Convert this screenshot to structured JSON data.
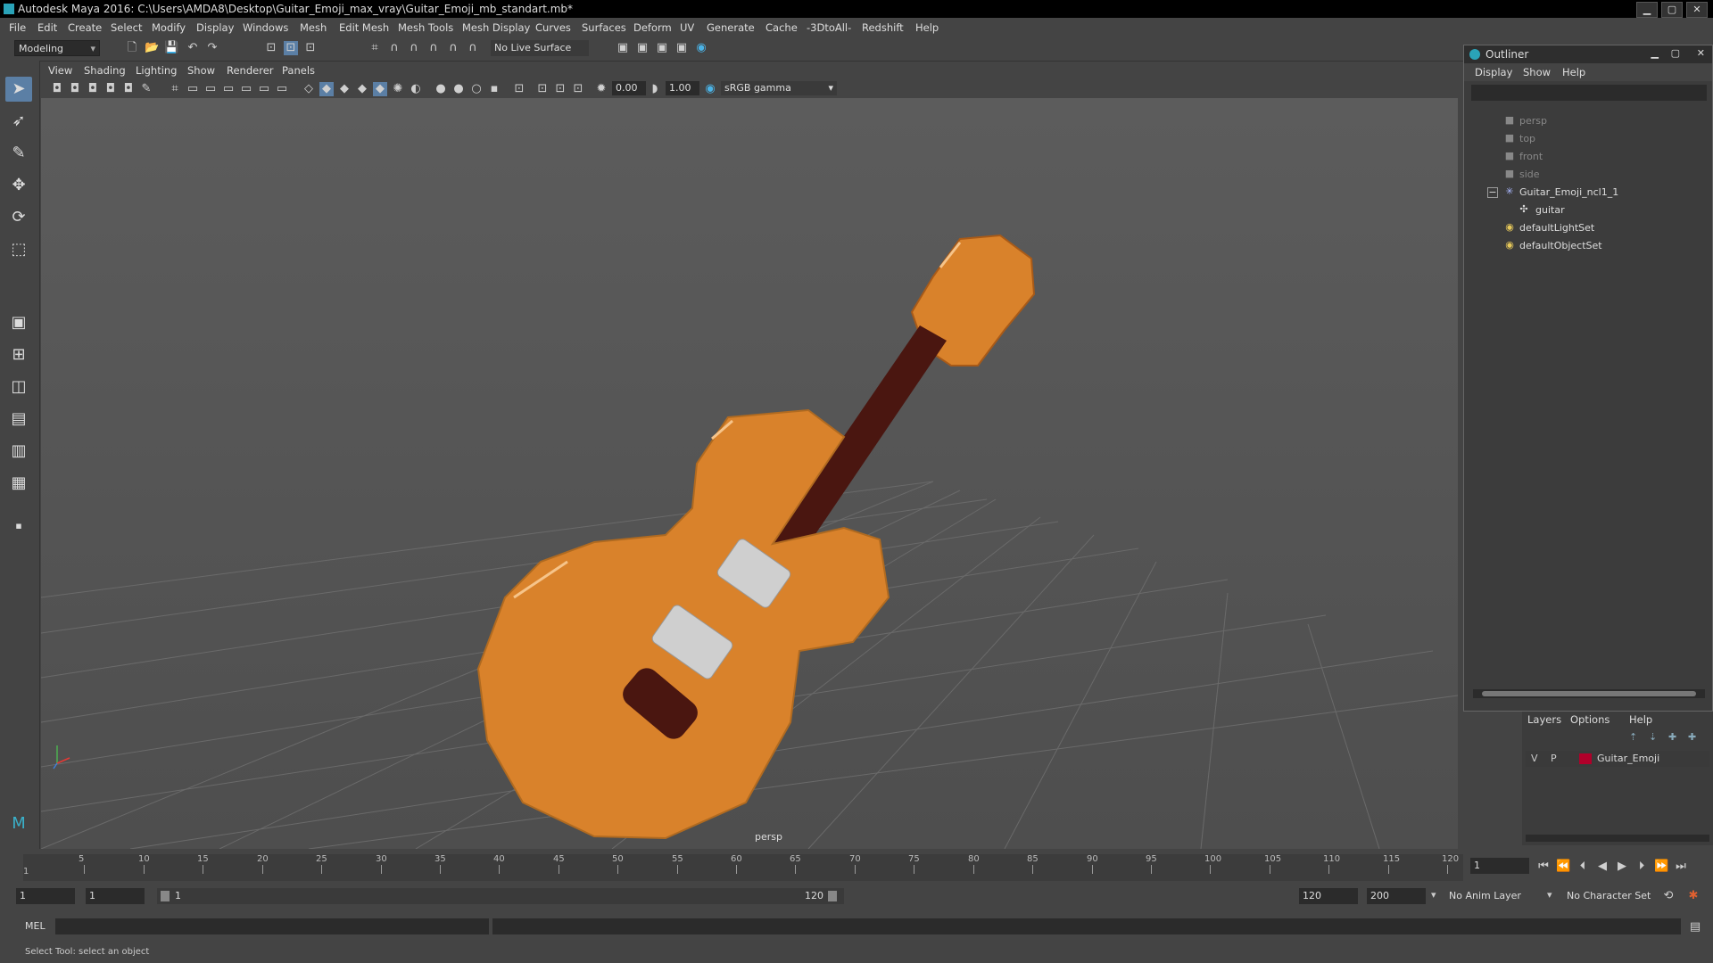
{
  "window": {
    "title": "Autodesk Maya 2016: C:\\Users\\AMDA8\\Desktop\\Guitar_Emoji_max_vray\\Guitar_Emoji_mb_standart.mb*"
  },
  "menubar": [
    "File",
    "Edit",
    "Create",
    "Select",
    "Modify",
    "Display",
    "Windows",
    "Mesh",
    "Edit Mesh",
    "Mesh Tools",
    "Mesh Display",
    "Curves",
    "Surfaces",
    "Deform",
    "UV",
    "Generate",
    "Cache",
    "-3DtoAll-",
    "Redshift",
    "Help"
  ],
  "shelf": {
    "mode": "Modeling",
    "live_surface": "No Live Surface"
  },
  "viewport": {
    "menu": [
      "View",
      "Shading",
      "Lighting",
      "Show",
      "Renderer",
      "Panels"
    ],
    "exposure": "0.00",
    "gamma": "1.00",
    "colorspace": "sRGB gamma",
    "camera_label": "persp"
  },
  "outliner": {
    "title": "Outliner",
    "menu": [
      "Display",
      "Show",
      "Help"
    ],
    "items": [
      {
        "label": "persp",
        "icon": "camera-icon"
      },
      {
        "label": "top",
        "icon": "camera-icon"
      },
      {
        "label": "front",
        "icon": "camera-icon"
      },
      {
        "label": "side",
        "icon": "camera-icon"
      },
      {
        "label": "Guitar_Emoji_ncl1_1",
        "icon": "group-icon",
        "expanded": true
      },
      {
        "label": "guitar",
        "icon": "mesh-icon"
      },
      {
        "label": "defaultLightSet",
        "icon": "set-icon"
      },
      {
        "label": "defaultObjectSet",
        "icon": "set-icon"
      }
    ]
  },
  "layers": {
    "menu": [
      "Layers",
      "Options",
      "Help"
    ],
    "row": {
      "v": "V",
      "p": "P",
      "name": "Guitar_Emoji",
      "color": "#b0002a"
    }
  },
  "timeline": {
    "ticks": [
      "5",
      "10",
      "15",
      "20",
      "25",
      "30",
      "35",
      "40",
      "45",
      "50",
      "55",
      "60",
      "65",
      "70",
      "75",
      "80",
      "85",
      "90",
      "95",
      "100",
      "105",
      "110",
      "115",
      "120"
    ],
    "start_marker": "1",
    "current_frame": "1"
  },
  "range": {
    "start": "1",
    "start2": "1",
    "slider_start": "1",
    "slider_end": "120",
    "end": "120",
    "max": "200",
    "anim_layer": "No Anim Layer",
    "char_set": "No Character Set"
  },
  "command": {
    "label": "MEL"
  },
  "help": {
    "text": "Select Tool: select an object"
  },
  "colors": {
    "guitar_body": "#d9822b",
    "guitar_neck": "#4a1610",
    "pickup": "#d0d0d0"
  }
}
